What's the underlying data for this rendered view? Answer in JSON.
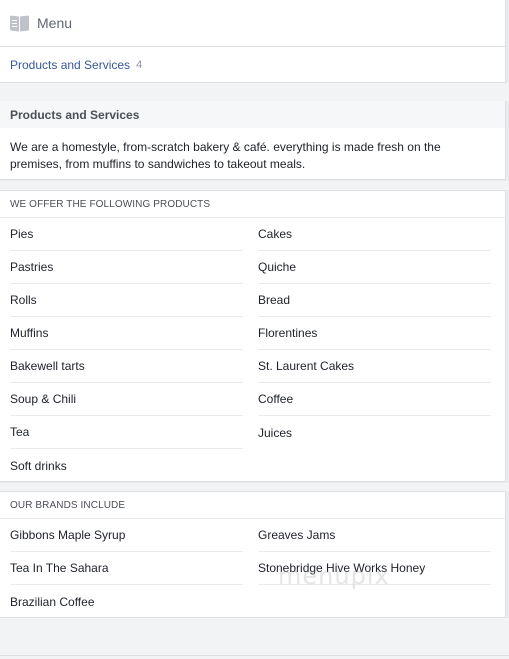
{
  "menu": {
    "title": "Menu",
    "icon": "book-icon"
  },
  "tab": {
    "label": "Products and Services",
    "count": "4"
  },
  "section": {
    "title": "Products and Services",
    "description": "We are a homestyle, from-scratch bakery & café. everything is made fresh on the premises, from muffins to sandwiches to takeout meals."
  },
  "products": {
    "header": "WE OFFER THE FOLLOWING PRODUCTS",
    "items": [
      "Pies",
      "Cakes",
      "Pastries",
      "Quiche",
      "Rolls",
      "Bread",
      "Muffins",
      "Florentines",
      "Bakewell tarts",
      "St. Laurent Cakes",
      "Soup & Chili",
      "Coffee",
      "Tea",
      "Juices",
      "Soft drinks"
    ]
  },
  "brands": {
    "header": "OUR BRANDS INCLUDE",
    "items": [
      "Gibbons Maple Syrup",
      "Greaves Jams",
      "Tea In The Sahara",
      "Stonebridge Hive Works Honey",
      "Brazilian Coffee"
    ]
  },
  "watermark": "menupix"
}
